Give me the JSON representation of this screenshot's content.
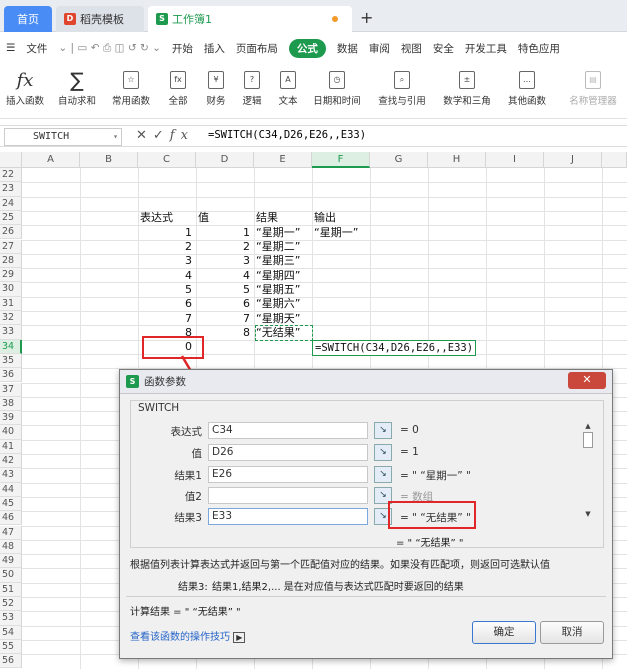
{
  "tabs": {
    "home": "首页",
    "template": "稻壳模板",
    "workbook": "工作簿1"
  },
  "menu": {
    "file": "文件",
    "items": [
      "开始",
      "插入",
      "页面布局",
      "公式",
      "数据",
      "审阅",
      "视图",
      "安全",
      "开发工具",
      "特色应用"
    ],
    "active": "公式"
  },
  "ribbon": [
    "插入函数",
    "自动求和",
    "常用函数",
    "全部",
    "财务",
    "逻辑",
    "文本",
    "日期和时间",
    "查找与引用",
    "数学和三角",
    "其他函数",
    "名称管理器"
  ],
  "formula_bar": {
    "name_box": "SWITCH",
    "formula": "=SWITCH(C34,D26,E26,,E33)"
  },
  "columns": [
    "A",
    "B",
    "C",
    "D",
    "E",
    "F",
    "G",
    "H",
    "I",
    "J"
  ],
  "rows": [
    "22",
    "23",
    "24",
    "25",
    "26",
    "27",
    "28",
    "29",
    "30",
    "31",
    "32",
    "33",
    "34",
    "35",
    "36",
    "37",
    "38",
    "39",
    "40",
    "41",
    "42",
    "43",
    "44",
    "45",
    "46",
    "47",
    "48",
    "49",
    "50",
    "51",
    "52",
    "53",
    "54",
    "55",
    "56"
  ],
  "sheet": {
    "headers": {
      "c": "表达式",
      "d": "值",
      "e": "结果",
      "f": "输出"
    },
    "c_values": [
      "1",
      "2",
      "3",
      "4",
      "5",
      "6",
      "7",
      "8",
      "0"
    ],
    "d_values": [
      "1",
      "2",
      "3",
      "4",
      "5",
      "6",
      "7",
      "8"
    ],
    "e_values": [
      "“星期一”",
      "“星期二”",
      "“星期三”",
      "“星期四”",
      "“星期五”",
      "“星期六”",
      "“星期天”",
      "“无结果”"
    ],
    "f26": "“星期一”",
    "f34": "=SWITCH(C34,D26,E26,,E33)"
  },
  "dialog": {
    "title": "函数参数",
    "function": "SWITCH",
    "args": [
      {
        "label": "表达式",
        "value": "C34",
        "result": "= 0"
      },
      {
        "label": "值",
        "value": "D26",
        "result": "= 1"
      },
      {
        "label": "结果1",
        "value": "E26",
        "result": "= \" “星期一” \""
      },
      {
        "label": "值2",
        "value": "",
        "result": "= 数组"
      },
      {
        "label": "结果3",
        "value": "E33",
        "result": "= \" “无结果” \""
      }
    ],
    "overall": "= \" “无结果” \"",
    "description": "根据值列表计算表达式并返回与第一个匹配值对应的结果。如果没有匹配项，则返回可选默认值",
    "arg_help_label": "结果3:",
    "arg_help": "结果1,结果2,... 是在对应值与表达式匹配时要返回的结果",
    "calc_result": "计算结果 = \" “无结果” \"",
    "help_link": "查看该函数的操作技巧",
    "ok": "确定",
    "cancel": "取消"
  },
  "colors": {
    "accent": "#1e9a4f",
    "highlight": "#e02626",
    "home_tab": "#4a8cf6"
  }
}
